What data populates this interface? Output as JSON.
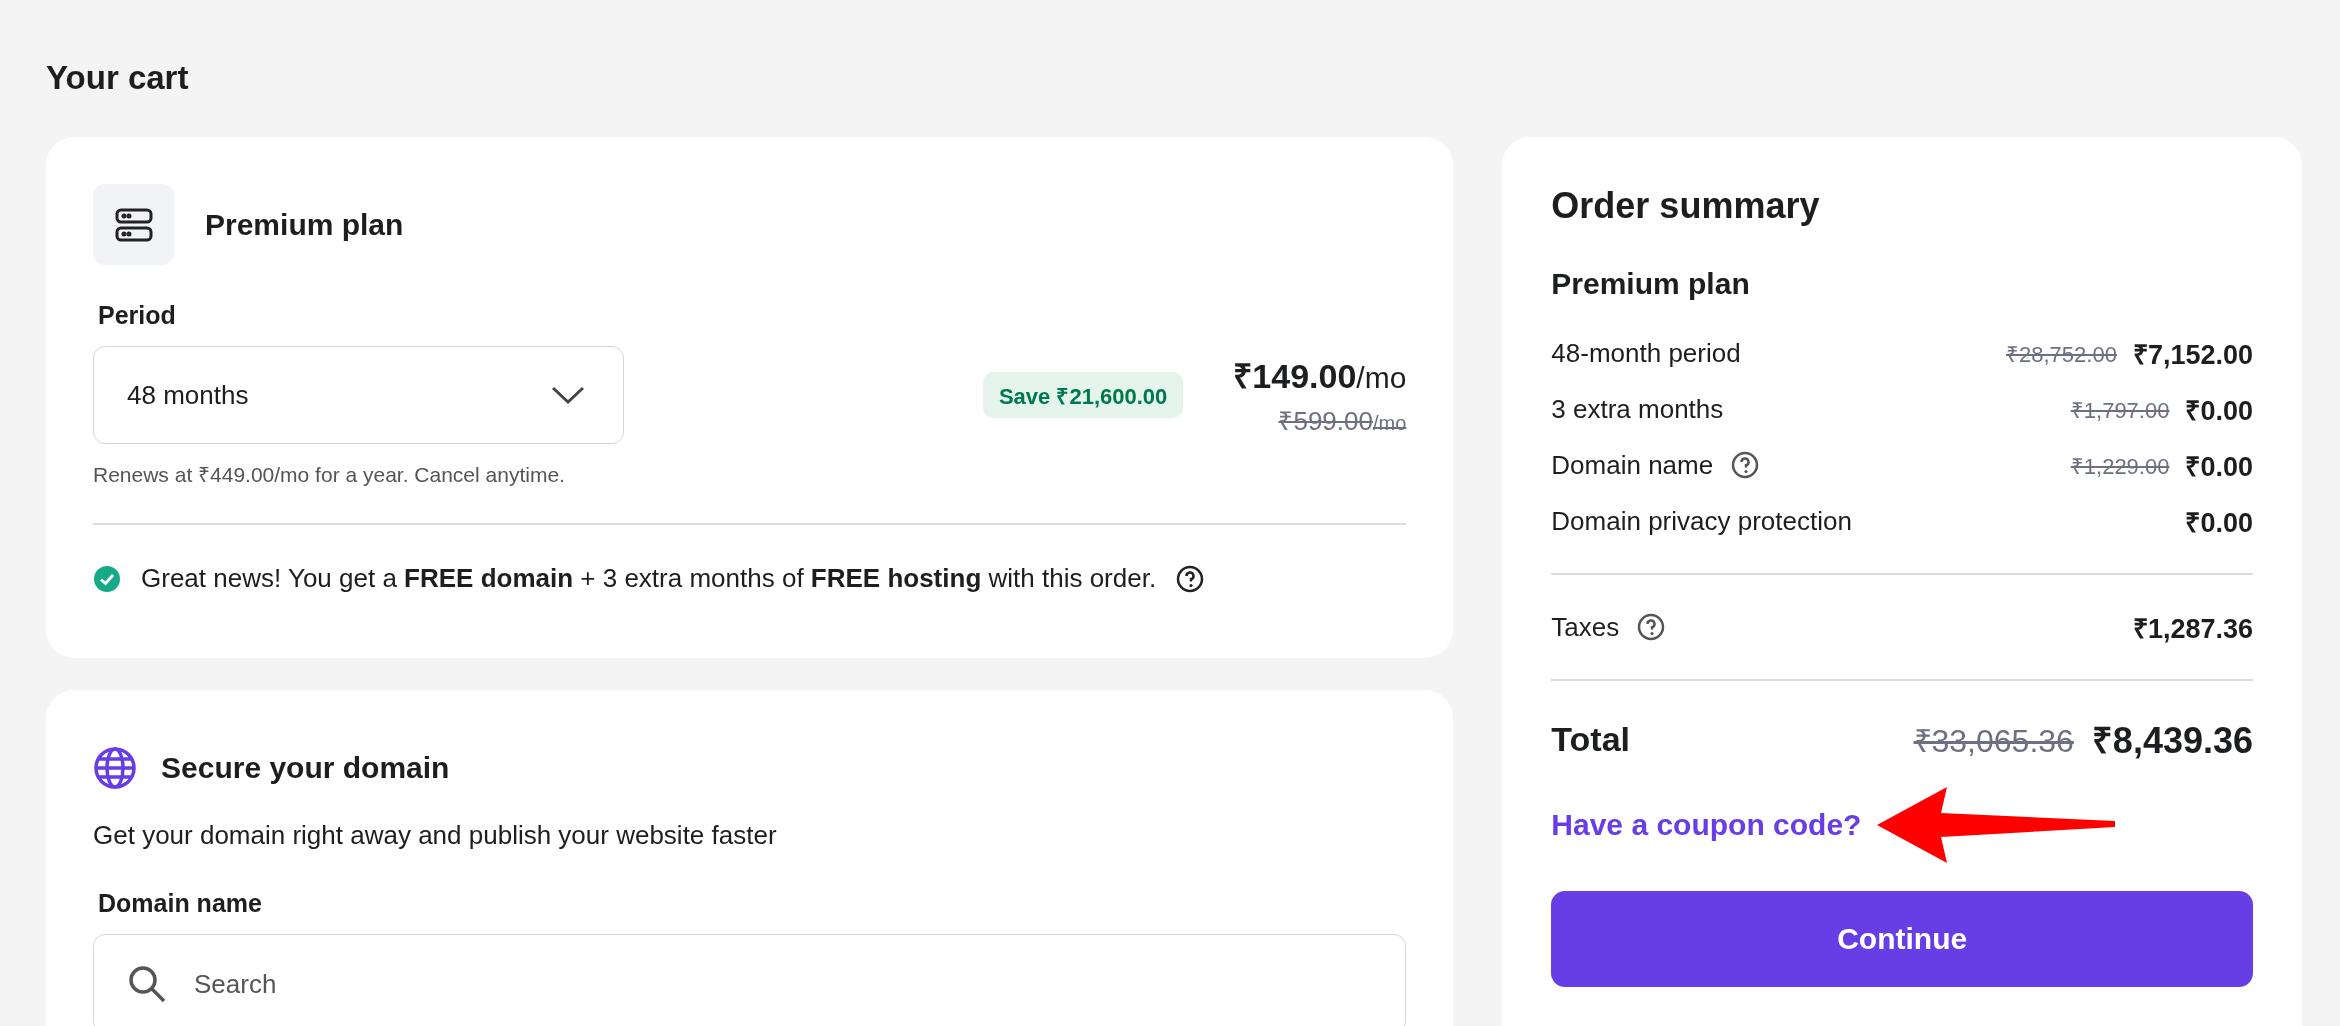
{
  "page_title": "Your cart",
  "plan_card": {
    "title": "Premium plan",
    "period_label": "Period",
    "period_value": "48 months",
    "save_badge": "Save ₹21,600.00",
    "price": "₹149.00",
    "price_unit": "/mo",
    "old_price": "₹599.00",
    "old_price_unit": "/mo",
    "renew_note": "Renews at ₹449.00/mo for a year. Cancel anytime.",
    "promo_note": "Great news! You get a **FREE domain** + 3 extra months of **FREE hosting** with this order."
  },
  "domain_card": {
    "title": "Secure your domain",
    "subtitle": "Get your domain right away and publish your website faster",
    "field_label": "Domain name",
    "search": {
      "placeholder": "Search"
    }
  },
  "order_summary": {
    "title": "Order summary",
    "plan_name": "Premium plan",
    "items": [
      {
        "label": "48-month period",
        "old_price": "₹28,752.00",
        "price": "₹7,152.00",
        "has_info": false
      },
      {
        "label": "3 extra months",
        "old_price": "₹1,797.00",
        "price": "₹0.00",
        "has_info": false
      },
      {
        "label": "Domain name",
        "old_price": "₹1,229.00",
        "price": "₹0.00",
        "has_info": true
      },
      {
        "label": "Domain privacy protection",
        "price": "₹0.00",
        "has_info": false
      }
    ],
    "taxes": {
      "label": "Taxes",
      "price": "₹1,287.36",
      "has_info": true
    },
    "total": {
      "label": "Total",
      "old_price": "₹33,065.36",
      "price": "₹8,439.36"
    },
    "coupon_link": "Have a coupon code?",
    "continue_button": "Continue"
  }
}
